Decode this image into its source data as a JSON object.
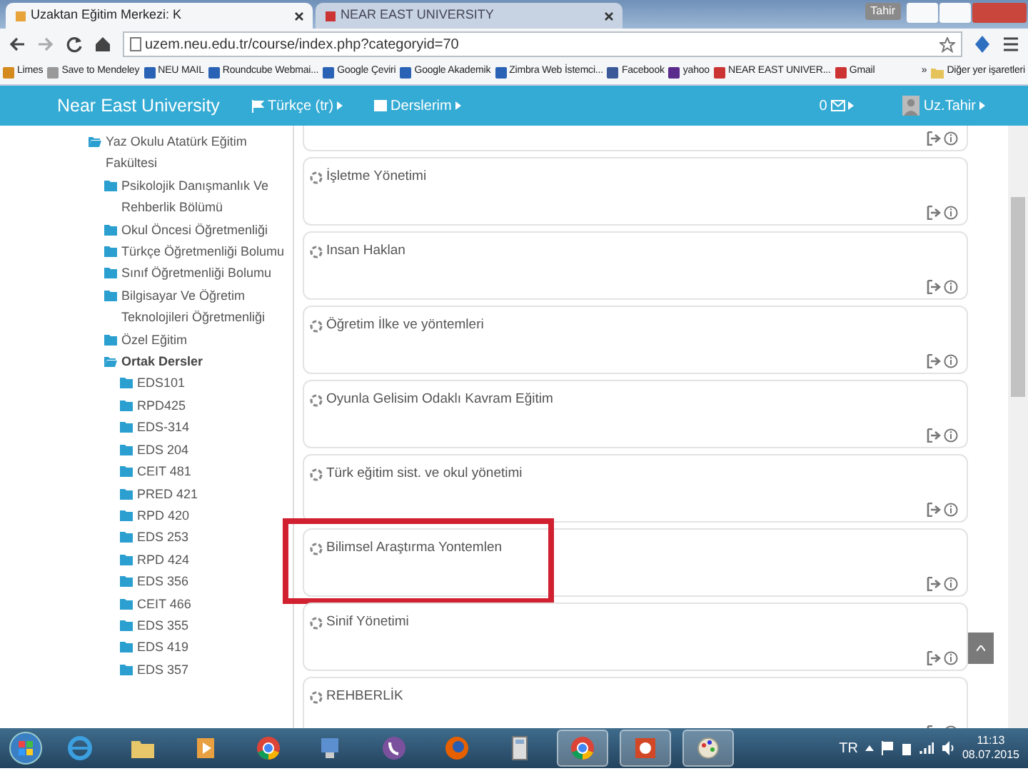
{
  "browser": {
    "user_badge": "Tahir",
    "tabs": [
      {
        "title": "Uzaktan Eğitim Merkezi: K",
        "selected": true
      },
      {
        "title": "NEAR EAST UNIVERSITY",
        "selected": false
      }
    ],
    "url": "uzem.neu.edu.tr/course/index.php?categoryid=70",
    "bookmarks": [
      "Limes",
      "Save to Mendeley",
      "NEU MAIL",
      "Roundcube Webmai...",
      "Google Çeviri",
      "Google Akademik",
      "Zimbra Web İstemci...",
      "Facebook",
      "yahoo",
      "NEAR EAST UNIVER...",
      "Gmail"
    ],
    "bookmarks_more": "»",
    "other_bookmarks": "Diğer yer işaretleri"
  },
  "navbar": {
    "brand": "Near East University",
    "language": "Türkçe (tr)",
    "my_courses": "Derslerim",
    "messages": "0",
    "user": "Uz.Tahir"
  },
  "sidebar": {
    "tree": [
      {
        "label": "Yaz Okulu Atatürk Eğitim Fakültesi",
        "expanded": true,
        "selected": false,
        "children": [
          {
            "label": "Psikolojik Danışmanlık Ve Rehberlik Bölümü",
            "expanded": false,
            "selected": false
          },
          {
            "label": "Okul Öncesi Öğretmenliği",
            "expanded": false,
            "selected": false
          },
          {
            "label": "Türkçe Öğretmenliği Bolumu",
            "expanded": false,
            "selected": false
          },
          {
            "label": "Sınıf Öğretmenliği Bolumu",
            "expanded": false,
            "selected": false
          },
          {
            "label": "Bilgisayar Ve Öğretim Teknolojileri Öğretmenliği",
            "expanded": false,
            "selected": false
          },
          {
            "label": "Özel Eğitim",
            "expanded": false,
            "selected": false
          },
          {
            "label": "Ortak Dersler",
            "expanded": true,
            "selected": true,
            "children": [
              {
                "label": "EDS101",
                "expanded": false,
                "selected": false
              },
              {
                "label": "RPD425",
                "expanded": false,
                "selected": false
              },
              {
                "label": "EDS-314",
                "expanded": false,
                "selected": false
              },
              {
                "label": "EDS 204",
                "expanded": false,
                "selected": false
              },
              {
                "label": "CEIT 481",
                "expanded": false,
                "selected": false
              },
              {
                "label": "PRED 421",
                "expanded": false,
                "selected": false
              },
              {
                "label": "RPD 420",
                "expanded": false,
                "selected": false
              },
              {
                "label": "EDS 253",
                "expanded": false,
                "selected": false
              },
              {
                "label": "RPD 424",
                "expanded": false,
                "selected": false
              },
              {
                "label": "EDS 356",
                "expanded": false,
                "selected": false
              },
              {
                "label": "CEIT 466",
                "expanded": false,
                "selected": false
              },
              {
                "label": "EDS 355",
                "expanded": false,
                "selected": false
              },
              {
                "label": "EDS 419",
                "expanded": false,
                "selected": false
              },
              {
                "label": "EDS 357",
                "expanded": false,
                "selected": false
              }
            ]
          }
        ]
      }
    ]
  },
  "courses": [
    {
      "highlighted": false
    },
    {
      "name": "İşletme Yönetimi",
      "highlighted": false
    },
    {
      "name": "Insan Haklan",
      "highlighted": false
    },
    {
      "name": "Öğretim İlke ve yöntemleri",
      "highlighted": false
    },
    {
      "name": "Oyunla Gelisim Odaklı Kavram Eğitim",
      "highlighted": false
    },
    {
      "name": "Türk eğitim sist. ve okul yönetimi",
      "highlighted": false
    },
    {
      "name": "Bilimsel Araştırma Yontemlen",
      "highlighted": true
    },
    {
      "name": "Sinif Yönetimi",
      "highlighted": false
    },
    {
      "name": "REHBERLİK",
      "highlighted": false
    }
  ],
  "taskbar": {
    "apps": [
      {
        "kind": "ie",
        "running": false
      },
      {
        "kind": "folder",
        "running": false
      },
      {
        "kind": "media",
        "running": false
      },
      {
        "kind": "chrome",
        "running": false
      },
      {
        "kind": "network",
        "running": false
      },
      {
        "kind": "viber",
        "running": false
      },
      {
        "kind": "firefox",
        "running": false
      },
      {
        "kind": "calc",
        "running": false
      },
      {
        "kind": "chrome",
        "running": true
      },
      {
        "kind": "ppt",
        "running": true
      },
      {
        "kind": "paint",
        "running": true
      }
    ],
    "language": "TR",
    "time": "11:13",
    "date": "08.07.2015"
  }
}
